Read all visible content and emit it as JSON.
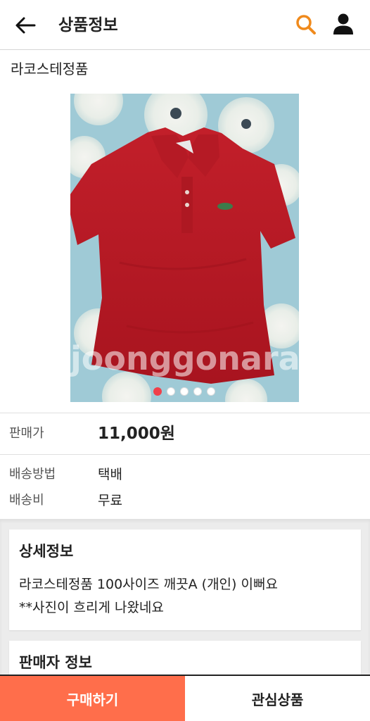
{
  "header": {
    "title": "상품정보",
    "back_icon": "arrow-left-icon",
    "search_icon": "search-icon",
    "user_icon": "user-icon",
    "accent_color": "#f08a1c"
  },
  "product": {
    "name": "라코스테정품",
    "image": {
      "watermark": "joonggonara",
      "total_images": 5,
      "active_index": 0
    }
  },
  "price": {
    "label": "판매가",
    "value": "11,000원"
  },
  "shipping": {
    "method_label": "배송방법",
    "method_value": "택배",
    "fee_label": "배송비",
    "fee_value": "무료"
  },
  "detail": {
    "title": "상세정보",
    "line1": "라코스테정품 100사이즈 깨끗A (개인) 이뻐요",
    "line2": "**사진이 흐리게 나왔네요"
  },
  "seller": {
    "title": "판매자 정보"
  },
  "bottom_bar": {
    "buy_label": "구매하기",
    "wish_label": "관심상품",
    "buy_color": "#ff6e4b"
  }
}
